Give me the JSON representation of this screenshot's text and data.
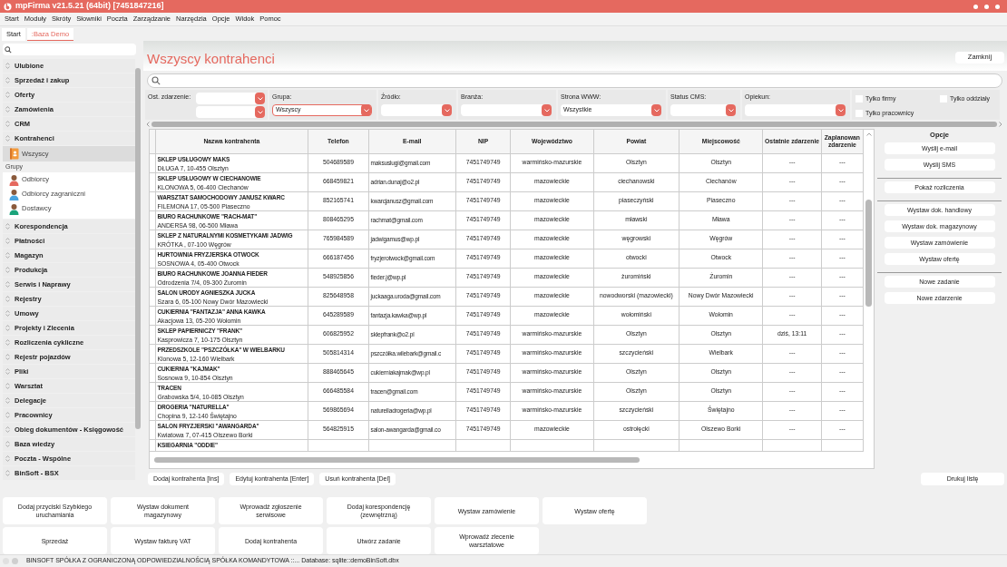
{
  "window": {
    "title": "mpFirma v21.5.21 (64bit) [7451847216]"
  },
  "menu": [
    "Start",
    "Moduły",
    "Skróty",
    "Słowniki",
    "Poczta",
    "Zarządzanie",
    "Narzędzia",
    "Opcje",
    "Widok",
    "Pomoc"
  ],
  "tabs": [
    {
      "label": "Start",
      "selected": false
    },
    {
      "label": ":Baza Demo",
      "selected": true
    }
  ],
  "sidebar": {
    "sections": [
      {
        "label": "Ulubione"
      },
      {
        "label": "Sprzedaż i zakup"
      },
      {
        "label": "Oferty"
      },
      {
        "label": "Zamówienia"
      },
      {
        "label": "CRM"
      },
      {
        "label": "Kontrahenci",
        "items": [
          {
            "label": "Wszyscy",
            "selected": true
          }
        ],
        "groups_label": "Grupy",
        "groups": [
          {
            "label": "Odbiorcy",
            "selected": false,
            "color": "#e5695f"
          },
          {
            "label": "Odbiorcy zagraniczni",
            "selected": false,
            "color": "#4aa3df"
          },
          {
            "label": "Dostawcy",
            "selected": false,
            "color": "#1aa37a"
          }
        ]
      },
      {
        "label": "Korespondencja"
      },
      {
        "label": "Płatności"
      },
      {
        "label": "Magazyn"
      },
      {
        "label": "Produkcja"
      },
      {
        "label": "Serwis i Naprawy"
      },
      {
        "label": "Rejestry"
      },
      {
        "label": "Umowy"
      },
      {
        "label": "Projekty i Zlecenia"
      },
      {
        "label": "Rozliczenia cykliczne"
      },
      {
        "label": "Rejestr pojazdów"
      },
      {
        "label": "Pliki"
      },
      {
        "label": "Warsztat"
      },
      {
        "label": "Delegacje"
      },
      {
        "label": "Pracownicy"
      },
      {
        "label": "Obieg dokumentów - Księgowość"
      },
      {
        "label": "Baza wiedzy"
      },
      {
        "label": "Poczta - Wspólne"
      },
      {
        "label": "BinSoft - BSX"
      }
    ]
  },
  "page": {
    "title": "Wszyscy kontrahenci",
    "close_button": "Zamknij"
  },
  "filters": [
    {
      "label": "Ost. zdarzenie:",
      "kind": "range"
    },
    {
      "label": "Grupa:",
      "kind": "dropdown",
      "value": "Wszyscy",
      "focused": true
    },
    {
      "label": "Źródło:",
      "kind": "dropdown",
      "focused": false
    },
    {
      "label": "Branża:",
      "kind": "dropdown",
      "focused": false
    },
    {
      "label": "Strona WWW:",
      "kind": "dropdown",
      "value": "Wszystkie",
      "focused": false
    },
    {
      "label": "Status CMS:",
      "kind": "dropdown",
      "focused": false
    },
    {
      "label": "Opiekun:",
      "kind": "dropdown",
      "focused": false
    }
  ],
  "checkboxes": [
    {
      "label": "Tylko firmy",
      "checked": false
    },
    {
      "label": "Tylko oddziały",
      "checked": false
    },
    {
      "label": "Tylko pracownicy",
      "checked": false
    }
  ],
  "table": {
    "columns": [
      "Nazwa kontrahenta",
      "Telefon",
      "E-mail",
      "NIP",
      "Województwo",
      "Powiat",
      "Miejscowość",
      "Ostatnie zdarzenie",
      "Zaplanowan zdarzenie"
    ],
    "rows": [
      {
        "name": "SKLEP USŁUGOWY MAKS",
        "address": "DŁUGA 7, 10-455 Olsztyn",
        "phone": "504689589",
        "email": "maksuslugi@gmail.com",
        "nip": "7451749749",
        "voivodeship": "warmińsko-mazurskie",
        "county": "Olsztyn",
        "city": "Olsztyn",
        "last_event": "---",
        "planned_event": "---"
      },
      {
        "name": "SKLEP USŁUGOWY W CIECHANOWIE",
        "address": "KLONOWA 5, 06-400 Ciechanów",
        "phone": "668459821",
        "email": "adrian.dunaj@o2.pl",
        "nip": "7451749749",
        "voivodeship": "mazowieckie",
        "county": "ciechanowski",
        "city": "Ciechanów",
        "last_event": "---",
        "planned_event": "---"
      },
      {
        "name": "WARSZTAT SAMOCHODOWY JANUSZ KWARC",
        "address": "FILEMONA 17, 05-500 Piaseczno",
        "phone": "852165741",
        "email": "kwarcjanusz@gmail.com",
        "nip": "7451749749",
        "voivodeship": "mazowieckie",
        "county": "piaseczyński",
        "city": "Piaseczno",
        "last_event": "---",
        "planned_event": "---"
      },
      {
        "name": "BIURO RACHUNKOWE \"RACH-MAT\"",
        "address": "ANDERSA 98, 06-500 Mława",
        "phone": "808465295",
        "email": "rachmat@gmail.com",
        "nip": "7451749749",
        "voivodeship": "mazowieckie",
        "county": "mławski",
        "city": "Mława",
        "last_event": "---",
        "planned_event": "---"
      },
      {
        "name": "SKLEP Z NATURALNYMI KOSMETYKAMI JADWIG",
        "address": "KRÓTKA , 07-100 Węgrów",
        "phone": "765984589",
        "email": "jadwigamus@wp.pl",
        "nip": "7451749749",
        "voivodeship": "mazowieckie",
        "county": "węgrowski",
        "city": "Węgrów",
        "last_event": "---",
        "planned_event": "---"
      },
      {
        "name": "HURTOWNIA FRYZJERSKA OTWOCK",
        "address": "SOSNOWA 4, 05-400 Otwock",
        "phone": "666187456",
        "email": "fryzjerotwock@gmail.com",
        "nip": "7451749749",
        "voivodeship": "mazowieckie",
        "county": "otwocki",
        "city": "Otwock",
        "last_event": "---",
        "planned_event": "---"
      },
      {
        "name": "BIURO RACHUNKOWE JOANNA FIEDER",
        "address": "Odrodzenia 7/4, 09-300 Żuromin",
        "phone": "548925856",
        "email": "fieder.j@wp.pl",
        "nip": "7451749749",
        "voivodeship": "mazowieckie",
        "county": "żuromiński",
        "city": "Żuromin",
        "last_event": "---",
        "planned_event": "---"
      },
      {
        "name": "SALON URODY AGNIESZKA JUCKA",
        "address": "Szara 6, 05-100 Nowy Dwór Mazowiecki",
        "phone": "825648958",
        "email": "juckaaga.uroda@gmail.com",
        "nip": "7451749749",
        "voivodeship": "mazowieckie",
        "county": "nowodworski (mazowiecki)",
        "city": "Nowy Dwór Mazowiecki",
        "last_event": "---",
        "planned_event": "---"
      },
      {
        "name": "CUKIERNIA \"FANTAZJA\" ANNA KAWKA",
        "address": "Akacjowa 13, 05-200 Wołomin",
        "phone": "645289589",
        "email": "fantazja.kawka@wp.pl",
        "nip": "7451749749",
        "voivodeship": "mazowieckie",
        "county": "wołomiński",
        "city": "Wołomin",
        "last_event": "---",
        "planned_event": "---"
      },
      {
        "name": "SKLEP PAPIERNICZY \"FRANK\"",
        "address": "Kasprowicza 7, 10-175 Olsztyn",
        "phone": "606825952",
        "email": "sklepfrank@o2.pl",
        "nip": "7451749749",
        "voivodeship": "warmińsko-mazurskie",
        "county": "Olsztyn",
        "city": "Olsztyn",
        "last_event": "dziś, 13:11",
        "planned_event": "---"
      },
      {
        "name": "PRZEDSZKOLE \"PSZCZÓŁKA\" W WIELBARKU",
        "address": "Klonowa 5, 12-160 Wielbark",
        "phone": "505814314",
        "email": "pszczółka.wilebark@gmail.c",
        "nip": "7451749749",
        "voivodeship": "warmińsko-mazurskie",
        "county": "szczycieński",
        "city": "Wielbark",
        "last_event": "---",
        "planned_event": "---"
      },
      {
        "name": "CUKIERNIA \"KAJMAK\"",
        "address": "Sosnowa 9, 10-854 Olsztyn",
        "phone": "888465645",
        "email": "cukierniakajmak@wp.pl",
        "nip": "7451749749",
        "voivodeship": "warmińsko-mazurskie",
        "county": "Olsztyn",
        "city": "Olsztyn",
        "last_event": "---",
        "planned_event": "---"
      },
      {
        "name": "TRACEN",
        "address": "Grabowska 5/4, 10-085 Olsztyn",
        "phone": "666485584",
        "email": "tracen@gmail.com",
        "nip": "7451749749",
        "voivodeship": "warmińsko-mazurskie",
        "county": "Olsztyn",
        "city": "Olsztyn",
        "last_event": "---",
        "planned_event": "---"
      },
      {
        "name": "DROGERIA \"NATURELLA\"",
        "address": "Chopina 9, 12-140 Świętajno",
        "phone": "569865694",
        "email": "naturelladrogeria@wp.pl",
        "nip": "7451749749",
        "voivodeship": "warmińsko-mazurskie",
        "county": "szczycieński",
        "city": "Świętajno",
        "last_event": "---",
        "planned_event": "---"
      },
      {
        "name": "SALON FRYZJERSKI \"AWANGARDA\"",
        "address": "Kwiatowa 7, 07-415 Olszewo Borki",
        "phone": "564825915",
        "email": "salon-awangarda@gmail.co",
        "nip": "7451749749",
        "voivodeship": "mazowieckie",
        "county": "ostrołęcki",
        "city": "Olszewo Borki",
        "last_event": "---",
        "planned_event": "---"
      },
      {
        "name": "KSIEGARNIA \"ODDIE\""
      }
    ]
  },
  "options": {
    "title": "Opcje",
    "groups": [
      [
        "Wyślij e-mail",
        "Wyślij SMS"
      ],
      [
        "Pokaż rozliczenia"
      ],
      [
        "Wystaw dok. handlowy",
        "Wystaw dok. magazynowy",
        "Wystaw zamówienie",
        "Wystaw ofertę"
      ],
      [
        "Nowe zadanie",
        "Nowe zdarzenie"
      ]
    ]
  },
  "table_buttons": [
    "Dodaj kontrahenta [Ins]",
    "Edytuj kontrahenta [Enter]",
    "Usuń kontrahenta [Del]"
  ],
  "print_button": "Drukuj listę",
  "quick_buttons": [
    [
      "Dodaj przyciski Szybkiego uruchamiania",
      "Wystaw dokument magazynowy",
      "Wprowadź zgłoszenie serwisowe",
      "Dodaj korespondencję (zewnętrzną)",
      "Wystaw zamówienie",
      "Wystaw ofertę"
    ],
    [
      "Sprzedaż",
      "Wystaw fakturę VAT",
      "Dodaj kontrahenta",
      "Utwórz zadanie",
      "Wprowadź zlecenie warsztatowe"
    ]
  ],
  "status_bar": "BINSOFT SPÓŁKA Z OGRANICZONĄ ODPOWIEDZIALNOŚCIĄ SPÓŁKA KOMANDYTOWA ::... Database: sqlite::demoBinSoft.dbx"
}
